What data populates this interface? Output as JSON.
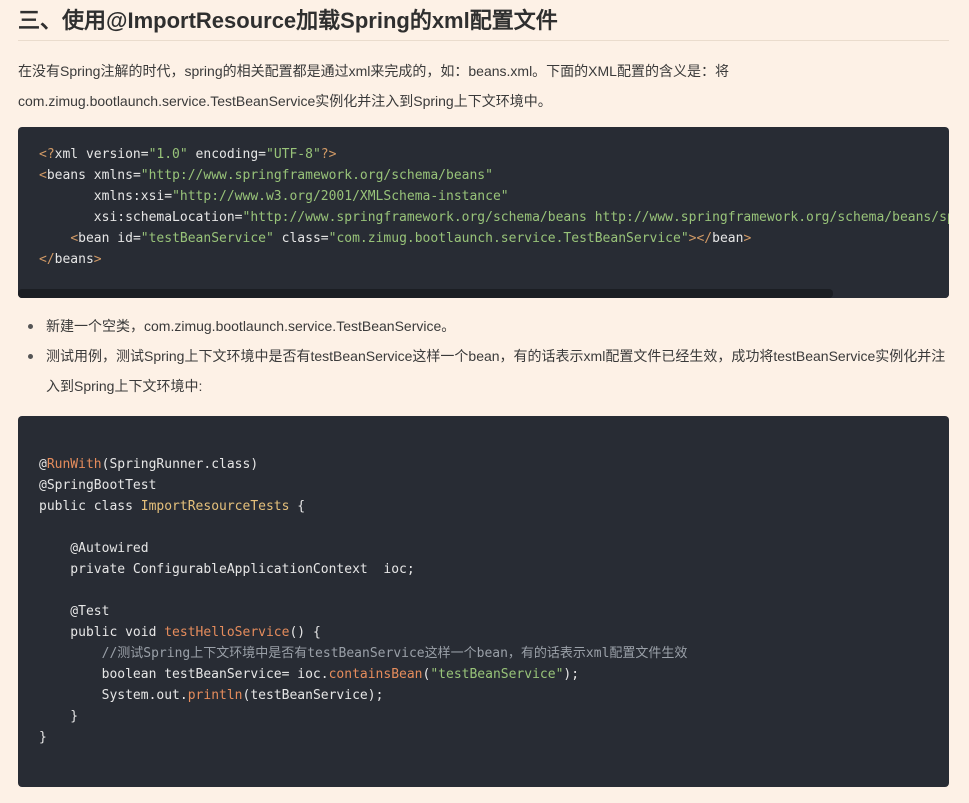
{
  "heading": "三、使用@ImportResource加载Spring的xml配置文件",
  "intro": "在没有Spring注解的时代，spring的相关配置都是通过xml来完成的，如：beans.xml。下面的XML配置的含义是：将com.zimug.bootlaunch.service.TestBeanService实例化并注入到Spring上下文环境中。",
  "xml_code": [
    [
      {
        "t": "t-punct",
        "v": "<?"
      },
      {
        "t": "t-prolog",
        "v": "xml version"
      },
      {
        "t": "t-plain",
        "v": "="
      },
      {
        "t": "t-string",
        "v": "\"1.0\""
      },
      {
        "t": "t-prolog",
        "v": " encoding"
      },
      {
        "t": "t-plain",
        "v": "="
      },
      {
        "t": "t-string",
        "v": "\"UTF-8\""
      },
      {
        "t": "t-punct",
        "v": "?>"
      }
    ],
    [
      {
        "t": "t-punct",
        "v": "<"
      },
      {
        "t": "t-tag",
        "v": "beans"
      },
      {
        "t": "t-attr",
        "v": " xmlns"
      },
      {
        "t": "t-plain",
        "v": "="
      },
      {
        "t": "t-string",
        "v": "\"http://www.springframework.org/schema/beans\""
      }
    ],
    [
      {
        "t": "t-attr",
        "v": "       xmlns:xsi"
      },
      {
        "t": "t-plain",
        "v": "="
      },
      {
        "t": "t-string",
        "v": "\"http://www.w3.org/2001/XMLSchema-instance\""
      }
    ],
    [
      {
        "t": "t-attr",
        "v": "       xsi:schemaLocation"
      },
      {
        "t": "t-plain",
        "v": "="
      },
      {
        "t": "t-string",
        "v": "\"http://www.springframework.org/schema/beans http://www.springframework.org/schema/beans/spri"
      }
    ],
    [
      {
        "t": "t-plain",
        "v": "    "
      },
      {
        "t": "t-punct",
        "v": "<"
      },
      {
        "t": "t-tag",
        "v": "bean"
      },
      {
        "t": "t-attr",
        "v": " id"
      },
      {
        "t": "t-plain",
        "v": "="
      },
      {
        "t": "t-string",
        "v": "\"testBeanService\""
      },
      {
        "t": "t-attr",
        "v": " class"
      },
      {
        "t": "t-plain",
        "v": "="
      },
      {
        "t": "t-string",
        "v": "\"com.zimug.bootlaunch.service.TestBeanService\""
      },
      {
        "t": "t-punct",
        "v": "></"
      },
      {
        "t": "t-tag",
        "v": "bean"
      },
      {
        "t": "t-punct",
        "v": ">"
      }
    ],
    [
      {
        "t": "t-punct",
        "v": "</"
      },
      {
        "t": "t-tag",
        "v": "beans"
      },
      {
        "t": "t-punct",
        "v": ">"
      }
    ]
  ],
  "bullets": [
    "新建一个空类，com.zimug.bootlaunch.service.TestBeanService。",
    "测试用例，测试Spring上下文环境中是否有testBeanService这样一个bean，有的话表示xml配置文件已经生效，成功将testBeanService实例化并注入到Spring上下文环境中:"
  ],
  "java_code": [
    [
      {
        "t": "t-at",
        "v": "@"
      },
      {
        "t": "t-method",
        "v": "RunWith"
      },
      {
        "t": "t-plain",
        "v": "(SpringRunner.class)"
      }
    ],
    [
      {
        "t": "t-plain",
        "v": "@SpringBootTest"
      }
    ],
    [
      {
        "t": "t-kw",
        "v": "public class "
      },
      {
        "t": "t-class",
        "v": "ImportResourceTests"
      },
      {
        "t": "t-plain",
        "v": " {"
      }
    ],
    [
      {
        "t": "t-plain",
        "v": ""
      }
    ],
    [
      {
        "t": "t-plain",
        "v": "    @Autowired"
      }
    ],
    [
      {
        "t": "t-plain",
        "v": "    private ConfigurableApplicationContext  ioc;"
      }
    ],
    [
      {
        "t": "t-plain",
        "v": ""
      }
    ],
    [
      {
        "t": "t-plain",
        "v": "    @Test"
      }
    ],
    [
      {
        "t": "t-kw",
        "v": "    public void "
      },
      {
        "t": "t-method",
        "v": "testHelloService"
      },
      {
        "t": "t-plain",
        "v": "() {"
      }
    ],
    [
      {
        "t": "t-comment",
        "v": "        //测试Spring上下文环境中是否有testBeanService这样一个bean，有的话表示xml配置文件生效"
      }
    ],
    [
      {
        "t": "t-plain",
        "v": "        boolean testBeanService= ioc."
      },
      {
        "t": "t-method",
        "v": "containsBean"
      },
      {
        "t": "t-plain",
        "v": "("
      },
      {
        "t": "t-string",
        "v": "\"testBeanService\""
      },
      {
        "t": "t-plain",
        "v": ");"
      }
    ],
    [
      {
        "t": "t-plain",
        "v": "        System.out."
      },
      {
        "t": "t-method",
        "v": "println"
      },
      {
        "t": "t-plain",
        "v": "(testBeanService);"
      }
    ],
    [
      {
        "t": "t-plain",
        "v": "    }"
      }
    ],
    [
      {
        "t": "t-plain",
        "v": "}"
      }
    ]
  ]
}
